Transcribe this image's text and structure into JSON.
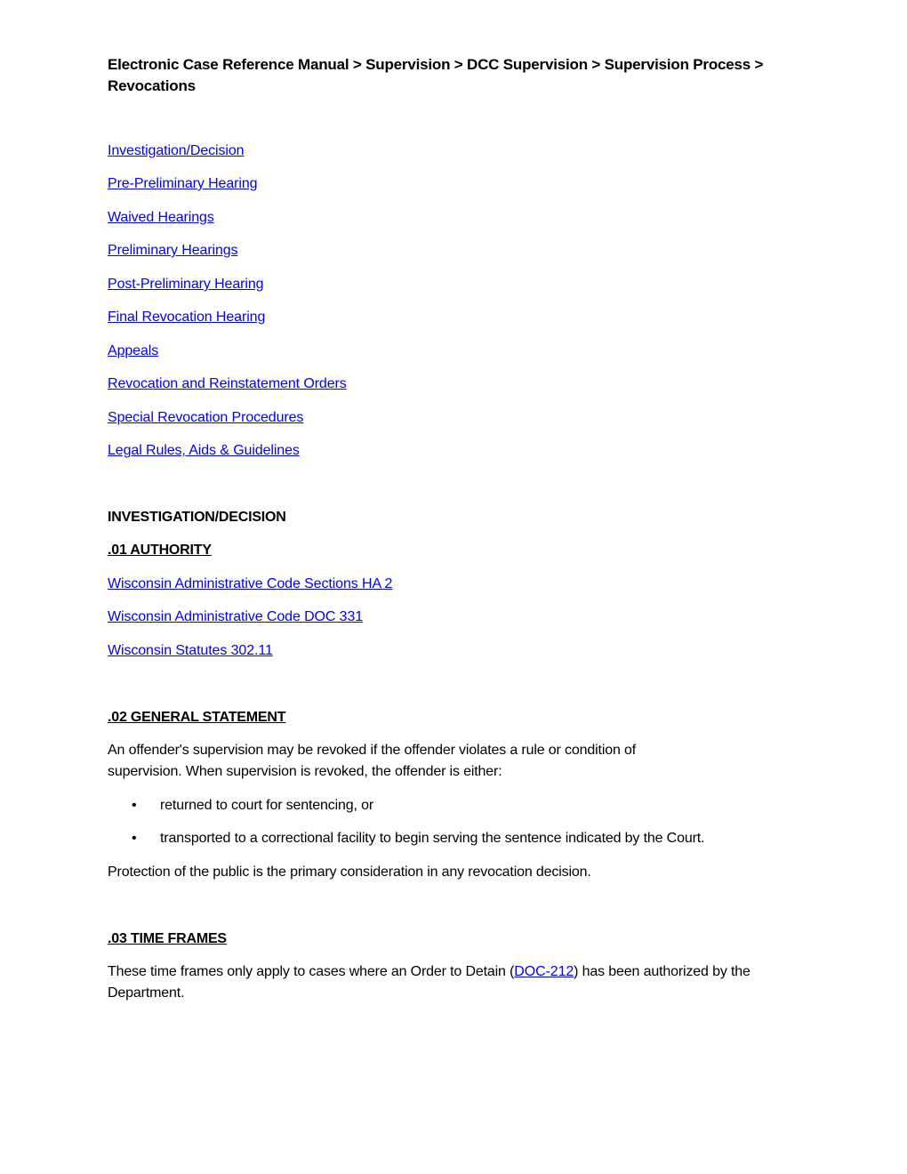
{
  "breadcrumb": {
    "text": "Electronic Case Reference Manual > Supervision > DCC Supervision > Supervision Process > Revocations"
  },
  "toc_links": [
    {
      "label": "Investigation/Decision"
    },
    {
      "label": "Pre-Preliminary Hearing"
    },
    {
      "label": "Waived Hearings"
    },
    {
      "label": "Preliminary Hearings"
    },
    {
      "label": "Post-Preliminary Hearing"
    },
    {
      "label": "Final Revocation Hearing"
    },
    {
      "label": "Appeals"
    },
    {
      "label": "Revocation and Reinstatement Orders"
    },
    {
      "label": "Special Revocation Procedures"
    },
    {
      "label": "Legal Rules, Aids & Guidelines"
    }
  ],
  "section": {
    "title": "INVESTIGATION/DECISION",
    "authority": {
      "heading": ".01 AUTHORITY",
      "links": [
        {
          "label": "Wisconsin Administrative Code Sections HA 2"
        },
        {
          "label": "Wisconsin Administrative Code DOC 331"
        },
        {
          "label": "Wisconsin Statutes 302.11"
        }
      ]
    },
    "general_statement": {
      "heading": ".02 GENERAL STATEMENT",
      "intro": "An offender's supervision may be revoked if the offender violates a rule or condition of supervision. When supervision is revoked, the offender is either:",
      "bullets": [
        "returned to court for sentencing, or",
        "transported to a correctional facility to begin serving the sentence indicated by the Court."
      ],
      "closing": "Protection of the public is the primary consideration in any revocation decision."
    },
    "time_frames": {
      "heading": ".03 TIME FRAMES",
      "text_before": "These time frames only apply to cases where an Order to Detain (",
      "link_label": "DOC-212",
      "text_after": ") has been authorized by the Department."
    }
  },
  "colors": {
    "link": "#0000ff",
    "text": "#000000"
  },
  "bullet_glyph": "•"
}
